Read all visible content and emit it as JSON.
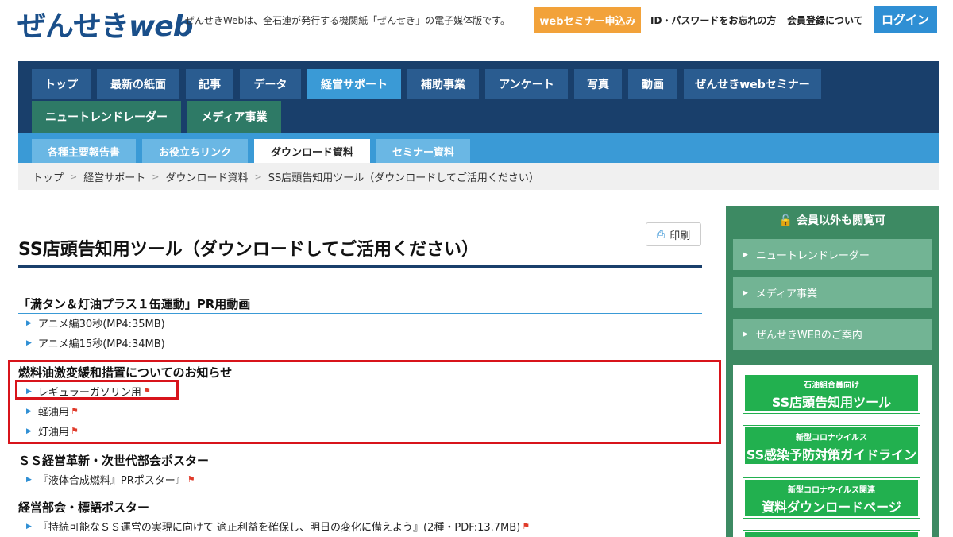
{
  "header": {
    "logo_main": "ぜんせき",
    "logo_web": "web",
    "tagline": "ぜんせきWebは、全石連が発行する機関紙「ぜんせき」の電子媒体版です。",
    "seminar_button": "webセミナー申込み",
    "forgot_link": "ID・パスワードをお忘れの方",
    "register_link": "会員登録について",
    "login_button": "ログイン"
  },
  "nav": {
    "items": [
      "トップ",
      "最新の紙面",
      "記事",
      "データ",
      "経営サポート",
      "補助事業",
      "アンケート",
      "写真",
      "動画",
      "ぜんせきwebセミナー",
      "ニュートレンドレーダー",
      "メディア事業"
    ],
    "active": "経営サポート"
  },
  "subnav": {
    "items": [
      "各種主要報告書",
      "お役立ちリンク",
      "ダウンロード資料",
      "セミナー資料"
    ],
    "active": "ダウンロード資料"
  },
  "breadcrumb": [
    "トップ",
    "経営サポート",
    "ダウンロード資料",
    "SS店頭告知用ツール（ダウンロードしてご活用ください）"
  ],
  "main": {
    "print_label": "印刷",
    "page_title": "SS店頭告知用ツール（ダウンロードしてご活用ください）",
    "sections": [
      {
        "title": "「満タン＆灯油プラス１缶運動」PR用動画",
        "links": [
          "アニメ編30秒(MP4:35MB)",
          "アニメ編15秒(MP4:34MB)"
        ]
      },
      {
        "title": "燃料油激変緩和措置についてのお知らせ",
        "links": [
          "レギュラーガソリン用",
          "軽油用",
          "灯油用"
        ]
      },
      {
        "title": "ＳＳ経営革新・次世代部会ポスター",
        "links": [
          "『液体合成燃料』PRポスター』"
        ]
      },
      {
        "title": "経営部会・標語ポスター",
        "links": [
          "『持続可能なＳＳ運営の実現に向けて 適正利益を確保し、明日の変化に備えよう』(2種・PDF:13.7MB)"
        ]
      }
    ]
  },
  "sidebar": {
    "header": "会員以外も閲覧可",
    "items": [
      "ニュートレンドレーダー",
      "メディア事業",
      "ぜんせきWEBのご案内"
    ],
    "banners": [
      {
        "small": "石油組合員向け",
        "big": "SS店頭告知用ツール"
      },
      {
        "small": "新型コロナウイルス",
        "big": "SS感染予防対策ガイドライン"
      },
      {
        "small": "新型コロナウイルス関連",
        "big": "資料ダウンロードページ"
      }
    ]
  },
  "colors": {
    "navy": "#193f6b",
    "accent_blue": "#3a9ad6",
    "orange": "#f2a23a",
    "green": "#3d8a63",
    "highlight_red": "#d8141b"
  }
}
